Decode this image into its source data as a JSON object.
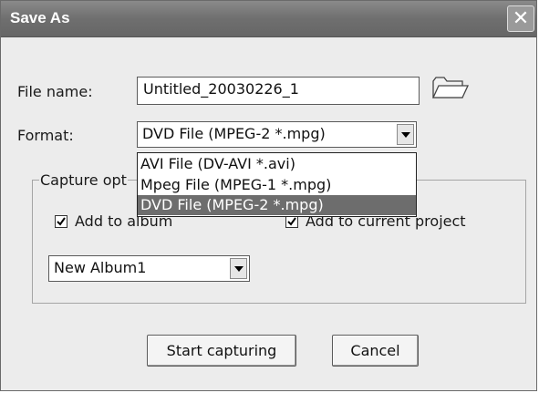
{
  "window": {
    "title": "Save As",
    "close_icon": "close-icon"
  },
  "file_name": {
    "label": "File name:",
    "value": "Untitled_20030226_1",
    "browse_icon": "folder-icon"
  },
  "format": {
    "label": "Format:",
    "selected": "DVD File (MPEG-2 *.mpg)",
    "options": [
      "AVI File (DV-AVI *.avi)",
      "Mpeg File (MPEG-1 *.mpg)",
      "DVD File (MPEG-2 *.mpg)"
    ],
    "highlighted_index": 2
  },
  "capture_options": {
    "label": "Capture opt",
    "add_to_album": {
      "label": "Add to album",
      "checked": true
    },
    "add_to_project": {
      "label": "Add to current project",
      "checked": true
    },
    "album": {
      "selected": "New Album1"
    }
  },
  "buttons": {
    "start": "Start capturing",
    "cancel": "Cancel"
  },
  "colors": {
    "titlebar": "#6f6f6f",
    "selection": "#6d6d6d",
    "dialog_bg": "#ececec"
  }
}
